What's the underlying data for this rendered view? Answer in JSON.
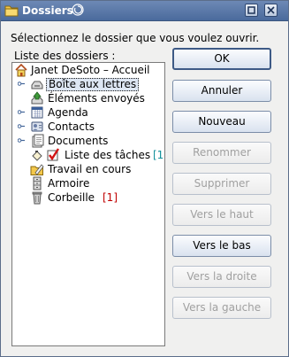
{
  "window": {
    "title": "Dossiers"
  },
  "prompt": "Sélectionnez le dossier que vous voulez ouvrir.",
  "tree": {
    "label": "Liste des dossiers :",
    "root": {
      "label": "Janet DeSoto – Accueil",
      "icon": "home-icon"
    },
    "items": [
      {
        "label": "Boîte aux lettres",
        "icon": "mailbox-icon",
        "selected": true,
        "expandable": true
      },
      {
        "label": "Éléments envoyés",
        "icon": "sent-items-icon"
      },
      {
        "label": "Agenda",
        "icon": "calendar-icon",
        "expandable": true
      },
      {
        "label": "Contacts",
        "icon": "contacts-icon",
        "expandable": true
      },
      {
        "label": "Documents",
        "icon": "documents-icon",
        "expandable": true
      },
      {
        "label": "Liste des tâches",
        "icon": "task-list-icon",
        "count": "[1]"
      },
      {
        "label": "Travail en cours",
        "icon": "work-in-progress-icon"
      },
      {
        "label": "Armoire",
        "icon": "cabinet-icon"
      },
      {
        "label": "Corbeille",
        "icon": "trash-icon",
        "count": "[1]"
      }
    ]
  },
  "buttons": {
    "ok": "OK",
    "cancel": "Annuler",
    "new": "Nouveau",
    "rename": "Renommer",
    "delete": "Supprimer",
    "move_up": "Vers le haut",
    "move_down": "Vers le bas",
    "move_right": "Vers la droite",
    "move_left": "Vers la gauche"
  },
  "colors": {
    "titlebar": "#5a78a8",
    "count_task": "#0f8f9a",
    "count_trash": "#c00000"
  }
}
